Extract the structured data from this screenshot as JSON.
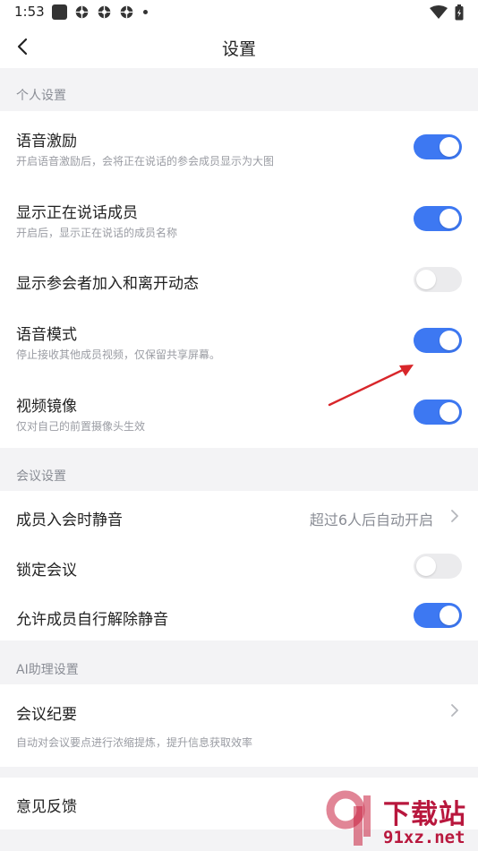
{
  "status_bar": {
    "time": "1:53"
  },
  "header": {
    "title": "设置"
  },
  "sections": {
    "personal": {
      "label": "个人设置",
      "items": [
        {
          "title": "语音激励",
          "subtitle": "开启语音激励后，会将正在说话的参会成员显示为大图",
          "on": true
        },
        {
          "title": "显示正在说话成员",
          "subtitle": "开启后，显示正在说话的成员名称",
          "on": true
        },
        {
          "title": "显示参会者加入和离开动态",
          "on": false
        },
        {
          "title": "语音模式",
          "subtitle": "停止接收其他成员视频，仅保留共享屏幕。",
          "on": true
        },
        {
          "title": "视频镜像",
          "subtitle": "仅对自己的前置摄像头生效",
          "on": true
        }
      ]
    },
    "meeting": {
      "label": "会议设置",
      "items": [
        {
          "title": "成员入会时静音",
          "value": "超过6人后自动开启"
        },
        {
          "title": "锁定会议",
          "on": false
        },
        {
          "title": "允许成员自行解除静音",
          "on": true
        }
      ]
    },
    "ai": {
      "label": "AI助理设置",
      "items": [
        {
          "title": "会议纪要",
          "subtitle": "自动对会议要点进行浓缩提炼，提升信息获取效率"
        }
      ]
    },
    "other": {
      "items": [
        {
          "title": "意见反馈"
        }
      ]
    }
  },
  "watermark": {
    "title": "下载站",
    "site": "91xz.net"
  },
  "colors": {
    "accent": "#3d78f2",
    "toggle_off": "#ebebed",
    "background": "#f3f3f5",
    "annotation_arrow": "#d8262a",
    "watermark": "#b8173d"
  },
  "icons": [
    "back-arrow-icon",
    "chevron-right-icon",
    "wifi-icon",
    "battery-icon",
    "notification-square-icon",
    "notification-gear-icon"
  ]
}
